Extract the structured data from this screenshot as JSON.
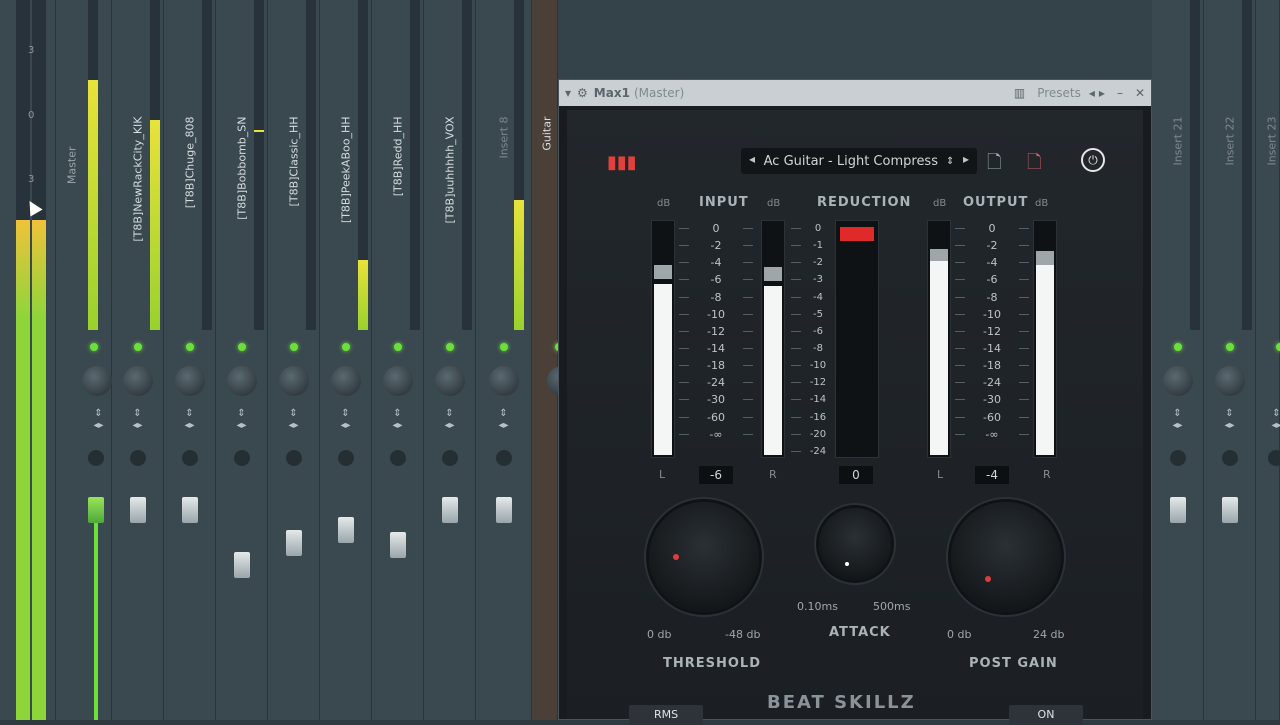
{
  "window": {
    "title": "Max1",
    "subtitle": "(Master)",
    "presets_label": "Presets"
  },
  "mixer": {
    "master_label": "Master",
    "tracks": [
      {
        "label": "[T8B]NewRackCity_KIK"
      },
      {
        "label": "[T8B]Chuge_808"
      },
      {
        "label": "[T8B]Bobbomb_SN"
      },
      {
        "label": "[T8B]Classic_HH"
      },
      {
        "label": "[T8B]PeekABoo_HH"
      },
      {
        "label": "[T8B]Redd_HH"
      },
      {
        "label": "[T8B]uuhhhhh_VOX"
      },
      {
        "label": "Insert 8"
      },
      {
        "label": "Guitar"
      },
      {
        "label": "Insert 21"
      },
      {
        "label": "Insert 22"
      },
      {
        "label": "Insert 23"
      }
    ],
    "scale_marks": [
      "3",
      "0",
      "3"
    ]
  },
  "plugin": {
    "brand": "BEAT SKILLZ",
    "preset_name": "Ac Guitar - Light Compress",
    "input": {
      "label": "INPUT",
      "db_left": "dB",
      "db_right": "dB",
      "value": "-6",
      "left": "L",
      "right": "R",
      "level_fraction": 0.77
    },
    "reduction": {
      "label": "REDUCTION",
      "value": "0",
      "scale": [
        "0",
        "-1",
        "-2",
        "-3",
        "-4",
        "-5",
        "-6",
        "-8",
        "-10",
        "-12",
        "-14",
        "-16",
        "-20",
        "-24"
      ]
    },
    "output": {
      "label": "OUTPUT",
      "db_left": "dB",
      "db_right": "dB",
      "value": "-4",
      "left": "L",
      "right": "R",
      "level_fraction": 0.86
    },
    "db_scale": [
      "0",
      "-2",
      "-4",
      "-6",
      "-8",
      "-10",
      "-12",
      "-14",
      "-18",
      "-24",
      "-30",
      "-60",
      "-∞"
    ],
    "threshold": {
      "label": "THRESHOLD",
      "min": "0 db",
      "max": "-48 db"
    },
    "attack": {
      "label": "ATTACK",
      "min": "0.10ms",
      "max": "500ms"
    },
    "post_gain": {
      "label": "POST GAIN",
      "min": "0 db",
      "max": "24 db"
    },
    "buttons": {
      "rms": "RMS",
      "on": "ON"
    }
  }
}
